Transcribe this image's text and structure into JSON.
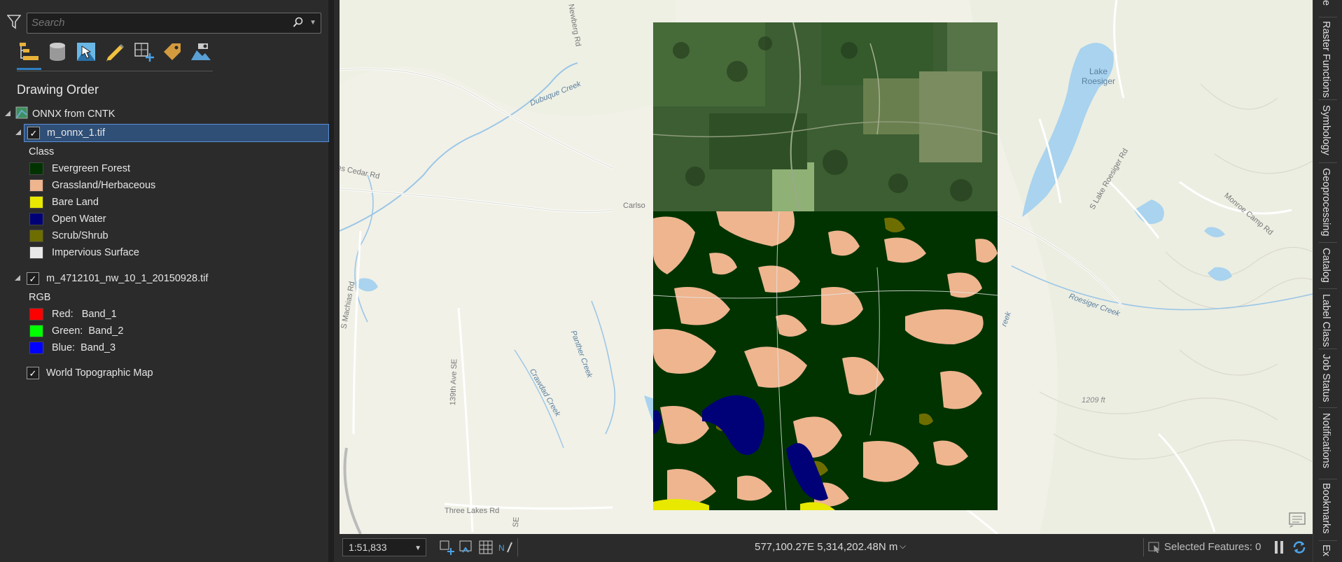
{
  "contents": {
    "search_placeholder": "Search",
    "pane_title": "Drawing Order",
    "view_icons": [
      "list-by-drawing-order-icon",
      "list-by-data-source-icon",
      "list-by-selection-icon",
      "list-by-editing-icon",
      "list-by-snapping-icon",
      "list-by-labeling-icon",
      "list-by-perspective-imagery-icon"
    ],
    "map_name": "ONNX from CNTK",
    "layer1": {
      "name": "m_onnx_1.tif",
      "checked": true,
      "renderer_label": "Class",
      "classes": [
        {
          "label": "Evergreen Forest",
          "color": "#003300"
        },
        {
          "label": "Grassland/Herbaceous",
          "color": "#eeb58f"
        },
        {
          "label": "Bare Land",
          "color": "#e8e800"
        },
        {
          "label": "Open Water",
          "color": "#000077"
        },
        {
          "label": "Scrub/Shrub",
          "color": "#6e6e00"
        },
        {
          "label": "Impervious Surface",
          "color": "#e8e8e8"
        }
      ]
    },
    "layer2": {
      "name": "m_4712101_nw_10_1_20150928.tif",
      "checked": true,
      "renderer_label": "RGB",
      "bands": [
        {
          "label": "Red:   Band_1",
          "color": "#ff0000"
        },
        {
          "label": "Green:  Band_2",
          "color": "#00ff00"
        },
        {
          "label": "Blue:  Band_3",
          "color": "#0000ff"
        }
      ]
    },
    "layer3": {
      "name": "World Topographic Map",
      "checked": true
    }
  },
  "map": {
    "labels": {
      "dubuque_creek": "Dubuque Creek",
      "newberg_rd": "Newberg Rd",
      "lake_roesiger": "Lake\nRoesiger",
      "carlson": "Carlso",
      "cedar": "es Cedar Rd",
      "s_machias": "S Machias Rd",
      "panther_creek": "Panther Creek",
      "crawdad_creek": "Crawdad Creek",
      "ave_139": "139th Ave SE",
      "three_lakes": "Three Lakes Rd",
      "roesiger_creek": "Roesiger Creek",
      "s_lake_roesiger": "S Lake Roesiger Rd",
      "monroe_camp": "Monroe Camp Rd",
      "elev_1209": "1209 ft",
      "reek": "reek",
      "se": "SE"
    }
  },
  "statusbar": {
    "scale": "1:51,833",
    "coordinates": "577,100.27E 5,314,202.48N m",
    "selected_features": "Selected Features: 0"
  },
  "rail": {
    "items": [
      "Raster Functions",
      "Symbology",
      "Geoprocessing",
      "Catalog",
      "Label Class",
      "Job Status",
      "Notifications",
      "Bookmarks"
    ],
    "partial_top": "te",
    "partial_bottom": "Ex"
  }
}
